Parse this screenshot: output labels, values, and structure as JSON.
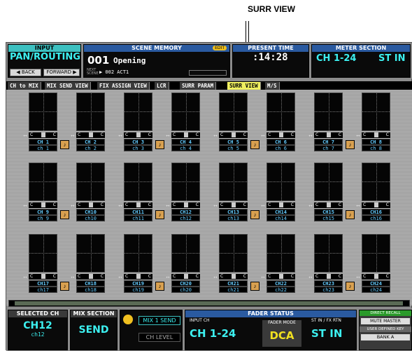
{
  "callout": {
    "label": "SURR VIEW"
  },
  "input": {
    "hdr": "INPUT",
    "value": "PAN/ROUTING",
    "back": "◀ BACK",
    "forward": "FORWARD ▶"
  },
  "scene": {
    "hdr": "SCENE MEMORY",
    "edit": "EDIT",
    "number": "001",
    "name": "Opening",
    "next_label": "NEXT SCENE",
    "next_value": "▶ 002 ACT1"
  },
  "time": {
    "hdr": "PRESENT TIME",
    "value": ":14:28"
  },
  "meter": {
    "hdr": "METER SECTION",
    "a": "CH 1-24",
    "b": "ST IN"
  },
  "tabs": [
    "CH to MIX",
    "MIX SEND VIEW",
    "FIX ASSIGN VIEW",
    "LCR",
    "SURR PARAM",
    "SURR VIEW",
    "M/S"
  ],
  "channels": [
    {
      "name": "CH 1",
      "short": "ch 1"
    },
    {
      "name": "CH 2",
      "short": "ch 2"
    },
    {
      "name": "CH 3",
      "short": "ch 3"
    },
    {
      "name": "CH 4",
      "short": "ch 4"
    },
    {
      "name": "CH 5",
      "short": "ch 5"
    },
    {
      "name": "CH 6",
      "short": "ch 6"
    },
    {
      "name": "CH 7",
      "short": "ch 7"
    },
    {
      "name": "CH 8",
      "short": "ch 8"
    },
    {
      "name": "CH 9",
      "short": "ch 9"
    },
    {
      "name": "CH10",
      "short": "ch10"
    },
    {
      "name": "CH11",
      "short": "ch11"
    },
    {
      "name": "CH12",
      "short": "ch12"
    },
    {
      "name": "CH13",
      "short": "ch13"
    },
    {
      "name": "CH14",
      "short": "ch14"
    },
    {
      "name": "CH15",
      "short": "ch15"
    },
    {
      "name": "CH16",
      "short": "ch16"
    },
    {
      "name": "CH17",
      "short": "ch17"
    },
    {
      "name": "CH18",
      "short": "ch18"
    },
    {
      "name": "CH19",
      "short": "ch19"
    },
    {
      "name": "CH20",
      "short": "ch20"
    },
    {
      "name": "CH21",
      "short": "ch21"
    },
    {
      "name": "CH22",
      "short": "ch22"
    },
    {
      "name": "CH23",
      "short": "ch23"
    },
    {
      "name": "CH24",
      "short": "ch24"
    }
  ],
  "lcr": {
    "c": "C"
  },
  "bottom": {
    "selected_hdr": "SELECTED CH",
    "selected_value": "CH12",
    "selected_sub": "ch12",
    "mix_hdr": "MIX SECTION",
    "mix_value": "SEND",
    "mix1send": "MIX 1 SEND",
    "chlevel": "CH LEVEL",
    "fader_hdr": "FADER STATUS",
    "input_ch_label": "INPUT CH",
    "input_ch_value": "CH 1-24",
    "fader_mode_label": "FADER MODE",
    "fader_mode_value": "DCA",
    "stin_label": "ST IN / FX RTN",
    "stin_value": "ST IN",
    "direct_recall": "DIRECT RECALL",
    "mute_master": "MUTE MASTER",
    "user_key": "USER DEFINED KEY",
    "bank": "BANK A"
  }
}
